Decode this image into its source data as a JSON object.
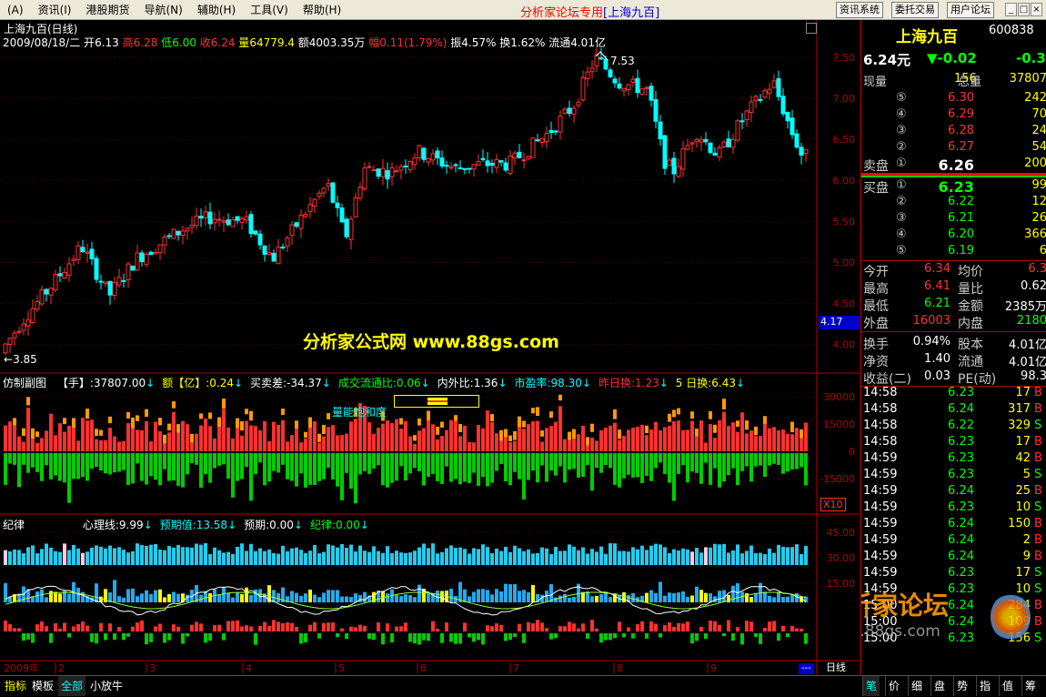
{
  "menu": [
    "(A)",
    "资讯(I)",
    "港股期货",
    "导航(N)",
    "辅助(H)",
    "工具(V)",
    "帮助(H)"
  ],
  "app_title": {
    "prefix": "分析家论坛专用",
    "instrument": "[上海九百]"
  },
  "top_buttons": [
    "资讯系统",
    "委托交易",
    "用户论坛"
  ],
  "main_chart": {
    "name": "上海九百(日线)",
    "date": "2009/08/18/二",
    "open_label": "开",
    "open": "6.13",
    "high_label": "高",
    "high": "6.28",
    "low_label": "低",
    "low": "6.00",
    "close_label": "收",
    "close": "6.24",
    "volume_label": "量",
    "volume": "64779.4",
    "amount_label": "额",
    "amount": "4003.35万",
    "change_label": "幅",
    "change": "0.11(1.79%)",
    "amplitude_label": "振",
    "amplitude": "4.57%",
    "turnover_label": "换",
    "turnover": "1.62%",
    "float_label": "流通",
    "float": "4.01亿",
    "high_marker": "7.53",
    "low_marker": "3.85",
    "current_price_tag": "4.17",
    "watermark": "分析家公式网 www.88gs.com",
    "y_ticks": [
      "7.50",
      "7.00",
      "6.50",
      "6.00",
      "5.50",
      "5.00",
      "4.50",
      "4.00"
    ]
  },
  "sub1": {
    "title": "仿制副图",
    "items": [
      {
        "label": "【手】:37807.00",
        "color": "#ffffff"
      },
      {
        "label": "额【亿】:0.24",
        "color": "#ffff00"
      },
      {
        "label": "买卖差:-34.37",
        "color": "#ffffff"
      },
      {
        "label": "成交流通比:0.06",
        "color": "#00ff00"
      },
      {
        "label": "内外比:1.36",
        "color": "#ffffff"
      },
      {
        "label": "市盈率:98.30",
        "color": "#00ffff"
      },
      {
        "label": "昨日换:1.23",
        "color": "#ff3030"
      },
      {
        "label": "5 日换:6.43",
        "color": "#ffff00"
      }
    ],
    "annotation": "量能饱和度",
    "y_ticks": [
      "30000",
      "15000",
      "0",
      "-15000"
    ],
    "multiplier": "X10"
  },
  "sub2": {
    "title": "纪律",
    "items": [
      {
        "label": "心理线:9.99",
        "color": "#ffffff"
      },
      {
        "label": "预期值:13.58",
        "color": "#00ffff"
      },
      {
        "label": "预期:0.00",
        "color": "#ffffff"
      },
      {
        "label": "纪律:0.00",
        "color": "#00ff00"
      }
    ],
    "y_ticks": [
      "45.00",
      "30.00",
      "15.00"
    ]
  },
  "x_axis": [
    "2009年",
    "2",
    "3",
    "4",
    "5",
    "6",
    "7",
    "8",
    "9"
  ],
  "quote": {
    "name": "上海九百",
    "code": "600838",
    "price": "6.24元",
    "change": "▼-0.02",
    "change_pct": "-0.3",
    "now_vol_label": "现量",
    "now_vol": "156",
    "total_vol_label": "总量",
    "total_vol": "37807",
    "asks": [
      {
        "level": "⑤",
        "price": "6.30",
        "vol": "242"
      },
      {
        "level": "④",
        "price": "6.29",
        "vol": "70"
      },
      {
        "level": "③",
        "price": "6.28",
        "vol": "24"
      },
      {
        "level": "②",
        "price": "6.27",
        "vol": "54"
      },
      {
        "level": "①",
        "price": "6.26",
        "vol": "200"
      }
    ],
    "ask_label": "卖盘",
    "bid_label": "买盘",
    "bids": [
      {
        "level": "①",
        "price": "6.23",
        "vol": "99"
      },
      {
        "level": "②",
        "price": "6.22",
        "vol": "12"
      },
      {
        "level": "③",
        "price": "6.21",
        "vol": "26"
      },
      {
        "level": "④",
        "price": "6.20",
        "vol": "366"
      },
      {
        "level": "⑤",
        "price": "6.19",
        "vol": "6"
      }
    ],
    "stats": [
      {
        "l1": "今开",
        "v1": "6.34",
        "c1": "#ff3030",
        "l2": "均价",
        "v2": "6.3",
        "c2": "#ff3030"
      },
      {
        "l1": "最高",
        "v1": "6.41",
        "c1": "#ff3030",
        "l2": "量比",
        "v2": "0.62",
        "c2": "#ffffff"
      },
      {
        "l1": "最低",
        "v1": "6.21",
        "c1": "#00ff00",
        "l2": "金额",
        "v2": "2385万",
        "c2": "#ffffff"
      },
      {
        "l1": "外盘",
        "v1": "16003",
        "c1": "#ff3030",
        "l2": "内盘",
        "v2": "2180",
        "c2": "#00ff00"
      },
      {
        "l1": "换手",
        "v1": "0.94%",
        "c1": "#ffffff",
        "l2": "股本",
        "v2": "4.01亿",
        "c2": "#ffffff"
      },
      {
        "l1": "净资",
        "v1": "1.40",
        "c1": "#ffffff",
        "l2": "流通",
        "v2": "4.01亿",
        "c2": "#ffffff"
      },
      {
        "l1": "收益(二)",
        "v1": "0.03",
        "c1": "#ffffff",
        "l2": "PE(动)",
        "v2": "98.3",
        "c2": "#ffffff"
      }
    ],
    "ticks": [
      {
        "time": "14:58",
        "price": "6.23",
        "vol": "17",
        "side": "B"
      },
      {
        "time": "14:58",
        "price": "6.24",
        "vol": "317",
        "side": "B"
      },
      {
        "time": "14:58",
        "price": "6.22",
        "vol": "329",
        "side": "S"
      },
      {
        "time": "14:58",
        "price": "6.23",
        "vol": "17",
        "side": "B"
      },
      {
        "time": "14:59",
        "price": "6.23",
        "vol": "42",
        "side": "B"
      },
      {
        "time": "14:59",
        "price": "6.23",
        "vol": "5",
        "side": "S"
      },
      {
        "time": "14:59",
        "price": "6.24",
        "vol": "25",
        "side": "B"
      },
      {
        "time": "14:59",
        "price": "6.23",
        "vol": "10",
        "side": "S"
      },
      {
        "time": "14:59",
        "price": "6.24",
        "vol": "150",
        "side": "B"
      },
      {
        "time": "14:59",
        "price": "6.24",
        "vol": "2",
        "side": "B"
      },
      {
        "time": "14:59",
        "price": "6.24",
        "vol": "9",
        "side": "B"
      },
      {
        "time": "14:59",
        "price": "6.23",
        "vol": "17",
        "side": "S"
      },
      {
        "time": "14:59",
        "price": "6.23",
        "vol": "10",
        "side": "S"
      },
      {
        "time": "15:00",
        "price": "6.24",
        "vol": "284",
        "side": "B"
      },
      {
        "time": "15:00",
        "price": "6.24",
        "vol": "109",
        "side": "B"
      },
      {
        "time": "15:00",
        "price": "6.23",
        "vol": "156",
        "side": "S"
      }
    ],
    "forum_watermark": "分析家论坛",
    "forum_url": "bbs.88gs.com",
    "side_tabs": [
      "笔",
      "价",
      "细",
      "盘",
      "势",
      "指",
      "值",
      "筹"
    ]
  },
  "bottom_tabs": [
    "指标",
    "模板",
    "全部",
    "小放牛"
  ],
  "period_label": "日线",
  "nav_dots": "---",
  "colors": {
    "up": "#ff3030",
    "down": "#00ffff",
    "bull_vol": "#ff3030",
    "bear_vol": "#00cc00",
    "accent": "#ffff00"
  }
}
